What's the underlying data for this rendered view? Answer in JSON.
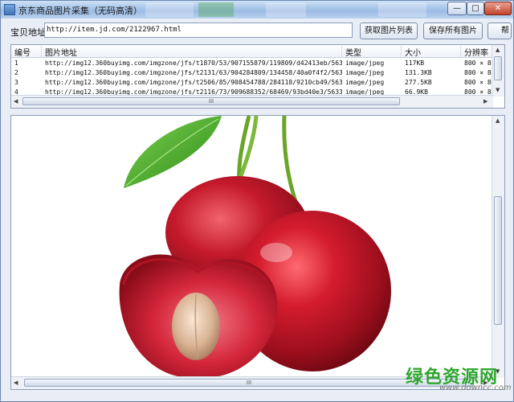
{
  "window": {
    "title": "京东商品图片采集（无码高清）",
    "controls": {
      "minimize": "—",
      "maximize": "□",
      "close": "✕"
    }
  },
  "toolbar": {
    "url_label": "宝贝地址:",
    "url_value": "http://item.jd.com/2122967.html",
    "fetch_button": "获取图片列表",
    "save_all_button": "保存所有图片",
    "help_button": "帮"
  },
  "table": {
    "columns": [
      "编号",
      "图片地址",
      "类型",
      "大小",
      "分辨率"
    ],
    "rows": [
      {
        "id": "1",
        "url": "http://img12.360buyimg.com/imgzone/jfs/t1870/53/907155879/119809/d42413eb/5633...",
        "type": "image/jpeg",
        "size": "117KB",
        "resolution": "800 × 8"
      },
      {
        "id": "2",
        "url": "http://img12.360buyimg.com/imgzone/jfs/t2131/63/904284809/134458/40a0f4f2/5633...",
        "type": "image/jpeg",
        "size": "131.3KB",
        "resolution": "800 × 8"
      },
      {
        "id": "3",
        "url": "http://img12.360buyimg.com/imgzone/jfs/t2506/85/908454788/284118/9210cb49/5633...",
        "type": "image/jpeg",
        "size": "277.5KB",
        "resolution": "800 × 8"
      },
      {
        "id": "4",
        "url": "http://img12.360buyimg.com/imgzone/jfs/t2116/73/909688352/68469/93bd40e3/56335...",
        "type": "image/jpeg",
        "size": "66.9KB",
        "resolution": "800 × 8"
      }
    ],
    "hscroll_grip": "III"
  },
  "preview": {
    "hscroll_grip": "III",
    "vscroll_grip": "≡"
  },
  "watermark": {
    "cn": "绿色资源网",
    "url": "www.downcc.com"
  },
  "colors": {
    "title_gradient_top": "#cfe2f6",
    "cherry_red": "#c0182a",
    "leaf_green": "#3f9a22",
    "watermark_green": "#2fa52f"
  }
}
